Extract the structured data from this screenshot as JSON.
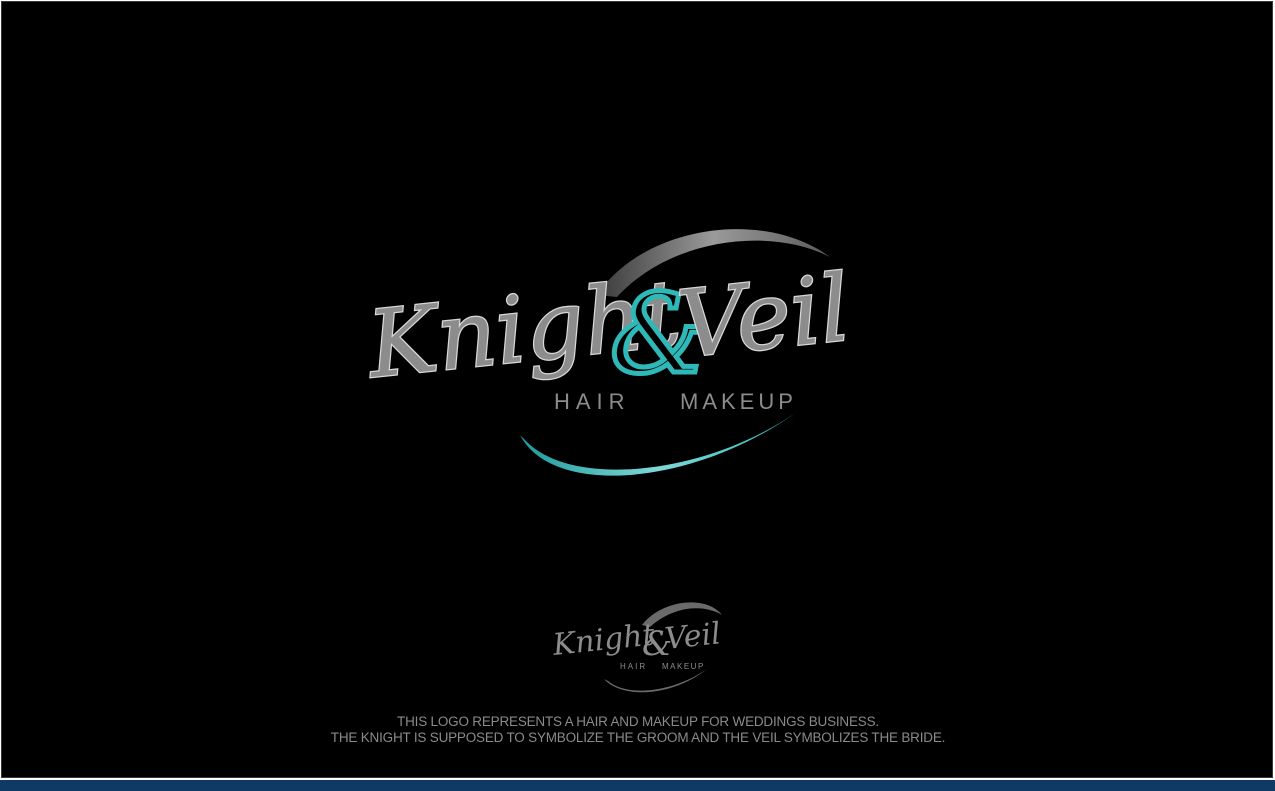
{
  "logo": {
    "word_left": "Knight",
    "ampersand": "&",
    "word_right": "Veil",
    "tagline_left": "HAIR",
    "tagline_right": "MAKEUP"
  },
  "caption": {
    "line1": "THIS LOGO REPRESENTS A HAIR AND MAKEUP FOR WEDDINGS BUSINESS.",
    "line2": "THE KNIGHT IS SUPPOSED TO SYMBOLIZE THE GROOM AND THE VEIL SYMBOLIZES THE BRIDE."
  },
  "colors": {
    "background": "#000000",
    "silver": "#8c8c8c",
    "teal": "#2fb8b8",
    "bottom_bar": "#0f3a66",
    "caption": "#8a8a8a"
  }
}
